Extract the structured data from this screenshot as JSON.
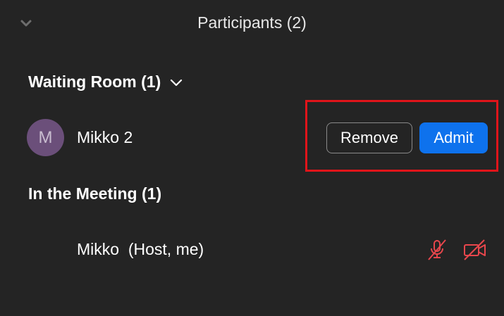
{
  "header": {
    "title": "Participants (2)",
    "collapse_icon": "chevron-down-icon"
  },
  "waiting_room": {
    "title": "Waiting Room (1)",
    "toggle_icon": "chevron-down-icon",
    "participants": [
      {
        "avatar_initial": "M",
        "name": "Mikko 2",
        "remove_label": "Remove",
        "admit_label": "Admit"
      }
    ]
  },
  "meeting": {
    "title": "In the Meeting (1)",
    "participants": [
      {
        "name": "Mikko  (Host, me)",
        "mic_icon": "mic-muted-icon",
        "video_icon": "video-off-icon"
      }
    ]
  },
  "colors": {
    "background": "#242424",
    "accent": "#0e72ed",
    "avatar": "#6b4f7a",
    "muted_red": "#e8464c",
    "highlight": "#e0141a"
  }
}
